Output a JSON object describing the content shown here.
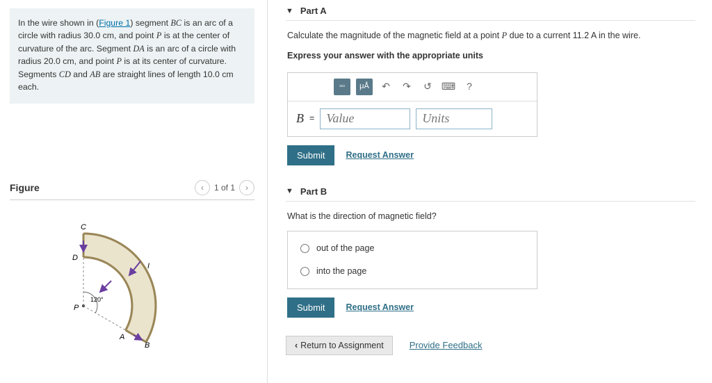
{
  "problem": {
    "pre_link": "In the wire shown in (",
    "figure_link": "Figure 1",
    "post_link": ") segment ",
    "seg1": "BC",
    "text1": " is an arc of a circle with radius 30.0 cm, and point ",
    "pt": "P",
    "text2": " is at the center of curvature of the arc. Segment ",
    "seg2": "DA",
    "text3": " is an arc of a circle with radius 20.0 cm, and point ",
    "text4": " is at its center of curvature. Segments ",
    "seg3": "CD",
    "text5": " and ",
    "seg4": "AB",
    "text6": " are straight lines of length 10.0 cm each."
  },
  "figure": {
    "title": "Figure",
    "pager": "1 of 1",
    "labels": {
      "C": "C",
      "D": "D",
      "A": "A",
      "B": "B",
      "P": "P",
      "I": "I",
      "angle": "120°"
    }
  },
  "partA": {
    "title": "Part A",
    "question_pre": "Calculate the magnitude of the magnetic field at a point ",
    "question_mid": " due to a current 11.2  A  in the wire.",
    "instruction": "Express your answer with the appropriate units",
    "toolbar": {
      "units_symbol": "μÅ",
      "help": "?"
    },
    "var": "B",
    "eq": "=",
    "value_ph": "Value",
    "units_ph": "Units",
    "submit": "Submit",
    "request": "Request Answer"
  },
  "partB": {
    "title": "Part B",
    "question": "What is the direction of magnetic field?",
    "opt1": "out of the page",
    "opt2": "into the page",
    "submit": "Submit",
    "request": "Request Answer"
  },
  "footer": {
    "return": "Return to Assignment",
    "feedback": "Provide Feedback"
  }
}
